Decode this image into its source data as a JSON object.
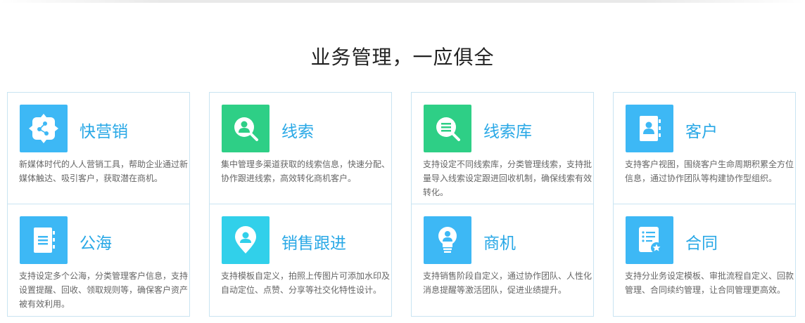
{
  "title": "业务管理，一应俱全",
  "colors": {
    "blue": "#3db8f5",
    "green": "#2ecf86",
    "cyan": "#31d0ea",
    "title_blue": "#29a8e6",
    "border": "#c9e4f2"
  },
  "cards": [
    {
      "title": "快营销",
      "icon": "share-nodes-icon",
      "icon_color": "#3db8f5",
      "desc": "新媒体时代的人人营销工具，帮助企业通过新媒体触达、吸引客户，获取潜在商机。"
    },
    {
      "title": "线索",
      "icon": "user-search-icon",
      "icon_color": "#2ecf86",
      "desc": "集中管理多渠道获取的线索信息，快速分配、协作跟进线索，高效转化商机客户。"
    },
    {
      "title": "线索库",
      "icon": "list-search-icon",
      "icon_color": "#2ecf86",
      "desc": "支持设定不同线索库，分类管理线索，支持批量导入线索设定跟进回收机制，确保线索有效转化。"
    },
    {
      "title": "客户",
      "icon": "contact-book-icon",
      "icon_color": "#3db8f5",
      "desc": "支持客户视图，围绕客户生命周期积累全方位信息，通过协作团队等构建协作型组织。"
    },
    {
      "title": "公海",
      "icon": "notebook-icon",
      "icon_color": "#3db8f5",
      "desc": "支持设定多个公海，分类管理客户信息，支持设置提醒、回收、领取规则等，确保客户资产被有效利用。"
    },
    {
      "title": "销售跟进",
      "icon": "location-pin-icon",
      "icon_color": "#31d0ea",
      "desc": "支持模板自定义，拍照上传图片可添加水印及自动定位、点赞、分享等社交化特性设计。"
    },
    {
      "title": "商机",
      "icon": "lightbulb-icon",
      "icon_color": "#3db8f5",
      "desc": "支持销售阶段自定义，通过协作团队、人性化消息提醒等激活团队，促进业绩提升。"
    },
    {
      "title": "合同",
      "icon": "contract-star-icon",
      "icon_color": "#3db8f5",
      "desc": "支持分业务设定模板、审批流程自定义、回款管理、合同续约管理，让合同管理更高效。"
    }
  ]
}
